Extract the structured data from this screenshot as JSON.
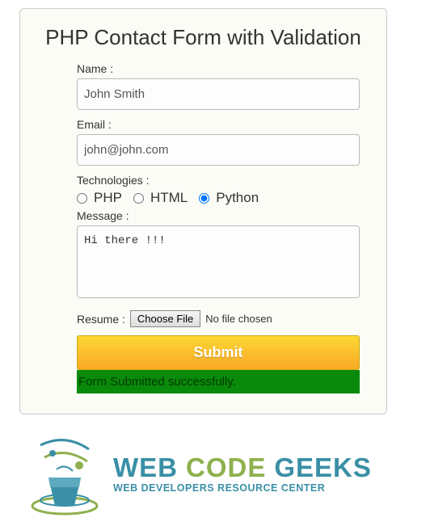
{
  "form": {
    "heading": "PHP Contact Form with Validation",
    "name_label": "Name :",
    "name_value": "John Smith",
    "email_label": "Email :",
    "email_value": "john@john.com",
    "tech_label": "Technologies :",
    "tech_options": {
      "php": "PHP",
      "html": "HTML",
      "python": "Python"
    },
    "message_label": "Message :",
    "message_value": "Hi there !!!",
    "resume_label": "Resume :",
    "file_button": "Choose File",
    "file_status": "No file chosen",
    "submit_label": "Submit",
    "success_message": "Form Submitted successfully."
  },
  "logo": {
    "word1": "WEB",
    "word2": "CODE",
    "word3": "GEEKS",
    "tagline": "WEB DEVELOPERS RESOURCE CENTER"
  }
}
